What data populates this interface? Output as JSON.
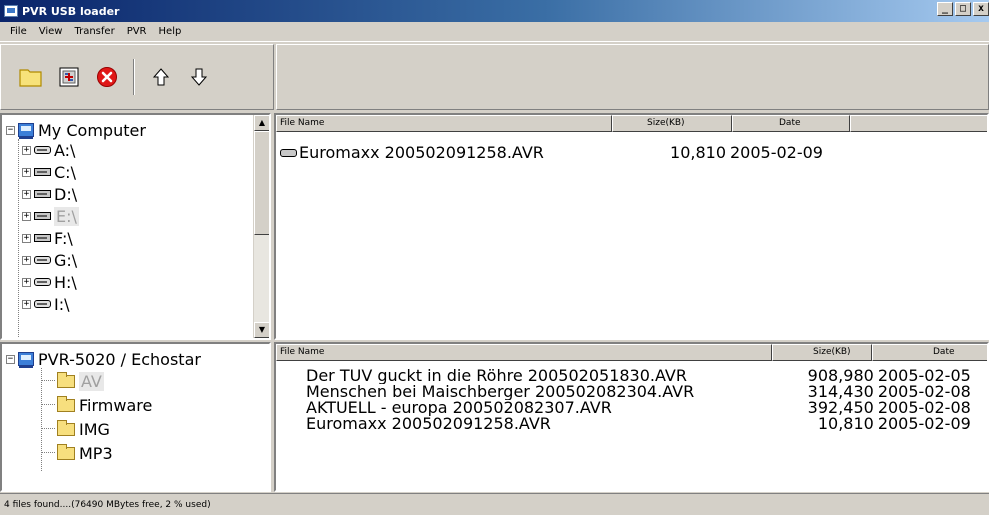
{
  "window": {
    "title": "PVR USB loader",
    "buttons": [
      "_",
      "□",
      "x"
    ]
  },
  "menu": [
    "File",
    "View",
    "Transfer",
    "PVR",
    "Help"
  ],
  "toolbar": {
    "icons": [
      "open-folder-icon",
      "settings-icon",
      "stop-icon",
      "arrow-up-icon",
      "arrow-down-icon"
    ]
  },
  "local_tree": {
    "root": "My Computer",
    "drives": [
      {
        "label": "A:\\",
        "type": "floppy"
      },
      {
        "label": "C:\\",
        "type": "disk"
      },
      {
        "label": "D:\\",
        "type": "disk"
      },
      {
        "label": "E:\\",
        "type": "disk",
        "selected": true
      },
      {
        "label": "F:\\",
        "type": "disk"
      },
      {
        "label": "G:\\",
        "type": "floppy"
      },
      {
        "label": "H:\\",
        "type": "floppy"
      },
      {
        "label": "I:\\",
        "type": "floppy"
      }
    ]
  },
  "local_list": {
    "columns": [
      "File Name",
      "Size(KB)",
      "Date"
    ],
    "rows": [
      {
        "name": "Euromaxx  200502091258.AVR",
        "size": "10,810",
        "date": "2005-02-09"
      }
    ]
  },
  "pvr_tree": {
    "root": "PVR-5020 / Echostar",
    "folders": [
      {
        "label": "AV",
        "selected": true
      },
      {
        "label": "Firmware"
      },
      {
        "label": "IMG"
      },
      {
        "label": "MP3"
      }
    ]
  },
  "pvr_list": {
    "columns": [
      "File Name",
      "Size(KB)",
      "Date"
    ],
    "rows": [
      {
        "name": "Der TÜV guckt in die Röhre  200502051830.AVR",
        "size": "908,980",
        "date": "2005-02-05"
      },
      {
        "name": "Menschen bei Maischberger  200502082304.AVR",
        "size": "314,430",
        "date": "2005-02-08"
      },
      {
        "name": "AKTUELL - europa  200502082307.AVR",
        "size": "392,450",
        "date": "2005-02-08"
      },
      {
        "name": "Euromaxx  200502091258.AVR",
        "size": "10,810",
        "date": "2005-02-09"
      }
    ]
  },
  "status": {
    "text": "4 files found....(76490 MBytes free, 2 % used)"
  }
}
